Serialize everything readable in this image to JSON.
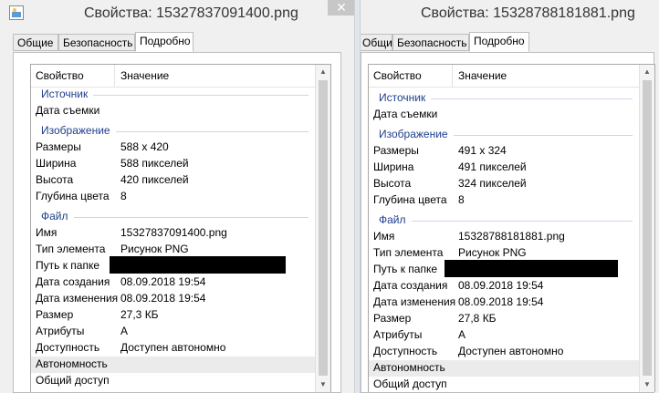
{
  "windows": [
    {
      "title": "Свойства: 15327837091400.png",
      "close_glyph": "✕",
      "tabs": [
        "Общие",
        "Безопасность",
        "Подробно"
      ],
      "active_tab": 2,
      "columns": {
        "property": "Свойство",
        "value": "Значение"
      },
      "groups": {
        "source": "Источник",
        "image": "Изображение",
        "file": "Файл"
      },
      "rows": {
        "date_taken": {
          "label": "Дата съемки",
          "value": ""
        },
        "dimensions": {
          "label": "Размеры",
          "value": "588 x 420"
        },
        "width": {
          "label": "Ширина",
          "value": "588 пикселей"
        },
        "height": {
          "label": "Высота",
          "value": "420 пикселей"
        },
        "bit_depth": {
          "label": "Глубина цвета",
          "value": "8"
        },
        "name": {
          "label": "Имя",
          "value": "15327837091400.png"
        },
        "item_type": {
          "label": "Тип элемента",
          "value": "Рисунок PNG"
        },
        "folder_path": {
          "label": "Путь к папке",
          "value": ""
        },
        "date_created": {
          "label": "Дата создания",
          "value": "08.09.2018 19:54"
        },
        "date_modified": {
          "label": "Дата изменения",
          "value": "08.09.2018 19:54"
        },
        "size": {
          "label": "Размер",
          "value": "27,3 КБ"
        },
        "attributes": {
          "label": "Атрибуты",
          "value": "A"
        },
        "availability": {
          "label": "Доступность",
          "value": "Доступен автономно"
        },
        "offline": {
          "label": "Автономность",
          "value": ""
        },
        "shared": {
          "label": "Общий доступ",
          "value": ""
        }
      }
    },
    {
      "title": "Свойства: 15328788181881.png",
      "tabs": [
        "Общие",
        "Безопасность",
        "Подробно"
      ],
      "active_tab": 2,
      "columns": {
        "property": "Свойство",
        "value": "Значение"
      },
      "groups": {
        "source": "Источник",
        "image": "Изображение",
        "file": "Файл"
      },
      "rows": {
        "date_taken": {
          "label": "Дата съемки",
          "value": ""
        },
        "dimensions": {
          "label": "Размеры",
          "value": "491 x 324"
        },
        "width": {
          "label": "Ширина",
          "value": "491 пикселей"
        },
        "height": {
          "label": "Высота",
          "value": "324 пикселей"
        },
        "bit_depth": {
          "label": "Глубина цвета",
          "value": "8"
        },
        "name": {
          "label": "Имя",
          "value": "15328788181881.png"
        },
        "item_type": {
          "label": "Тип элемента",
          "value": "Рисунок PNG"
        },
        "folder_path": {
          "label": "Путь к папке",
          "value": ""
        },
        "date_created": {
          "label": "Дата создания",
          "value": "08.09.2018 19:54"
        },
        "date_modified": {
          "label": "Дата изменения",
          "value": "08.09.2018 19:54"
        },
        "size": {
          "label": "Размер",
          "value": "27,8 КБ"
        },
        "attributes": {
          "label": "Атрибуты",
          "value": "A"
        },
        "availability": {
          "label": "Доступность",
          "value": "Доступен автономно"
        },
        "offline": {
          "label": "Автономность",
          "value": ""
        },
        "shared": {
          "label": "Общий доступ",
          "value": ""
        }
      }
    }
  ],
  "scroll_arrows": {
    "up": "▲",
    "down": "▼"
  },
  "icons": {
    "window_icon": "image-file-icon",
    "close": "close-icon"
  }
}
